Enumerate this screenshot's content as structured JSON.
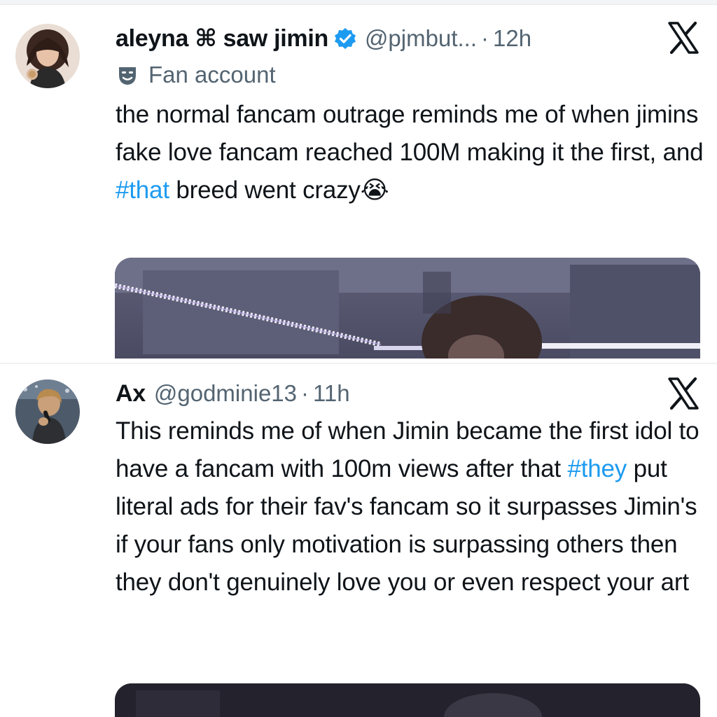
{
  "tweets": [
    {
      "author_name": "aleyna ⌘ saw jimin",
      "handle": "@pjmbut...",
      "separator": "·",
      "time": "12h",
      "label": "Fan account",
      "text": {
        "before": "the normal fancam outrage reminds me of when jimins fake love fancam reached 100M making it the first, and ",
        "hashtag": "#that",
        "after": " breed went crazy",
        "emoji": "😭"
      },
      "verified": true,
      "avatar_icon": "avatar-photo",
      "close_icon": "x-logo-icon"
    },
    {
      "author_name": "Ax",
      "handle": "@godminie13",
      "separator": "·",
      "time": "11h",
      "text": {
        "before": "This reminds me of when Jimin became the first idol to have a fancam with 100m views after that ",
        "hashtag": "#they",
        "after": " put literal ads for their fav's fancam so it surpasses Jimin's if your fans only motivation is surpassing others then they don't genuinely love you or even respect your art"
      },
      "verified": false,
      "avatar_icon": "avatar-photo",
      "close_icon": "x-logo-icon"
    }
  ],
  "colors": {
    "text": "#0f1419",
    "secondary": "#536471",
    "link": "#1d9bf0",
    "verified": "#1d9bf0"
  }
}
